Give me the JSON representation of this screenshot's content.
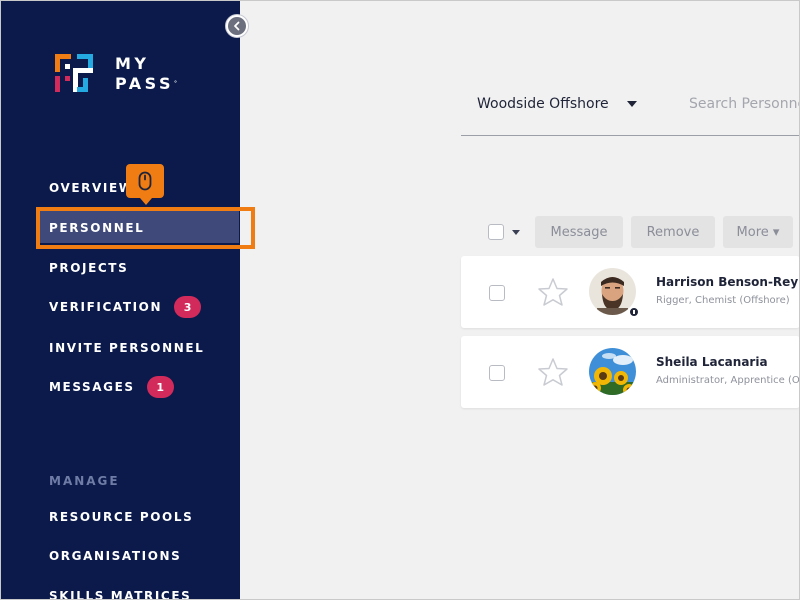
{
  "brand": {
    "logo_line1": "MY",
    "logo_line2": "PASS",
    "trademark": "°",
    "colors": {
      "orange": "#f07d13",
      "magenta": "#d22b5b",
      "cyan": "#24a9e1",
      "navy": "#0b1a4b"
    }
  },
  "sidebar": {
    "collapse_icon": "chevron-left-icon",
    "items": [
      {
        "label": "OVERVIEW",
        "id": "overview"
      },
      {
        "label": "PERSONNEL",
        "id": "personnel",
        "active": true
      },
      {
        "label": "PROJECTS",
        "id": "projects"
      },
      {
        "label": "VERIFICATION",
        "id": "verification",
        "badge": "3"
      },
      {
        "label": "INVITE PERSONNEL",
        "id": "invite-personnel"
      },
      {
        "label": "MESSAGES",
        "id": "messages",
        "badge": "1"
      }
    ],
    "manage_label": "MANAGE",
    "manage_items": [
      {
        "label": "RESOURCE POOLS"
      },
      {
        "label": "ORGANISATIONS"
      },
      {
        "label": "SKILLS MATRICES"
      }
    ],
    "tooltip_icon": "mouse-icon"
  },
  "main": {
    "org_select": "Woodside Offshore",
    "search_placeholder": "Search Personnel",
    "toolbar": {
      "message": "Message",
      "remove": "Remove",
      "more": "More ▾"
    },
    "people": [
      {
        "name": "Harrison Benson-Reynolds",
        "role": "Rigger, Chemist (Offshore)",
        "avatar": "bearded-man-avatar"
      },
      {
        "name": "Sheila Lacanaria",
        "role": "Administrator, Apprentice (Offshore)",
        "avatar": "sunflower-avatar"
      }
    ]
  }
}
